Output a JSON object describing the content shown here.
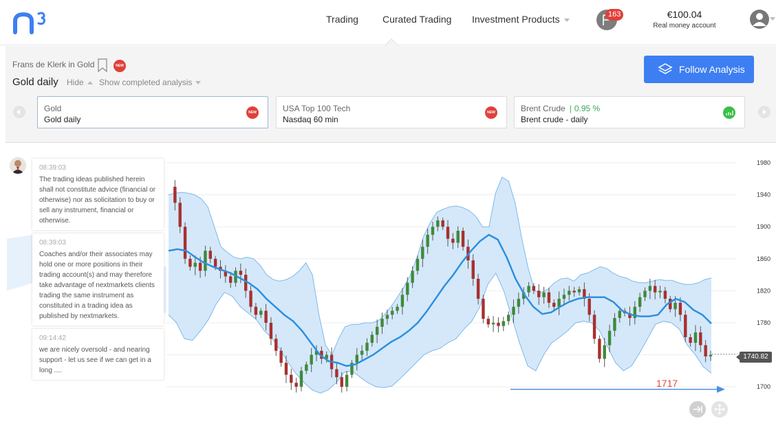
{
  "nav": {
    "logo_text": "n3",
    "items": [
      {
        "label": "Trading",
        "dropdown": false
      },
      {
        "label": "Curated Trading",
        "dropdown": false
      },
      {
        "label": "Investment Products",
        "dropdown": true
      }
    ],
    "notifications_count": "163",
    "account_balance": "€100.04",
    "account_type": "Real money account"
  },
  "analysis": {
    "breadcrumb": "Frans de Klerk in Gold",
    "new_badge": "NEW",
    "title": "Gold daily",
    "hide_label": "Hide",
    "show_completed_label": "Show completed analysis",
    "follow_button": "Follow Analysis",
    "cards": [
      {
        "market": "Gold",
        "name": "Gold daily",
        "change": "",
        "badge": "NEW",
        "active": true
      },
      {
        "market": "USA Top 100 Tech",
        "name": "Nasdaq 60 min",
        "change": "",
        "badge": "NEW",
        "active": false
      },
      {
        "market": "Brent Crude",
        "name": "Brent crude - daily",
        "change": "0.95 %",
        "badge": "chart-up-icon",
        "active": false
      }
    ]
  },
  "feed": [
    {
      "time": "08:39:03",
      "text": "The trading ideas published herein shall not constitute advice (financial or otherwise) nor as solicitation to buy or sell any instrument, financial or otherwise."
    },
    {
      "time": "08:39:03",
      "text": "Coaches and/or their associates may hold one or more positions in their trading account(s) and may therefore take advantage of nextmarkets clients trading the same instrument as constituted in a trading idea as published by nextmarkets."
    },
    {
      "time": "09:14:42",
      "text": "we are nicely oversold - and nearing support - let us see if we can get in a long ...."
    }
  ],
  "colors": {
    "accent": "#3d7ff2",
    "bollinger_fill": "#cce4f9",
    "bollinger_edge": "#7fb8ea",
    "mid_line": "#2e8fdc",
    "up_candle": "#3f8a3a",
    "down_candle": "#a83030",
    "annotation": "#e04a3c"
  },
  "chart_data": {
    "type": "candlestick",
    "ylim": [
      1680,
      1990
    ],
    "y_ticks": [
      "1980",
      "1940",
      "1900",
      "1860",
      "1820",
      "1780",
      "1740",
      "1700"
    ],
    "last_price": "1740.82",
    "support_level": 1717,
    "support_label": "1717",
    "price_path": [
      1950,
      1930,
      1900,
      1860,
      1850,
      1855,
      1845,
      1870,
      1860,
      1850,
      1845,
      1838,
      1830,
      1845,
      1840,
      1820,
      1800,
      1790,
      1795,
      1780,
      1760,
      1745,
      1730,
      1715,
      1705,
      1700,
      1720,
      1728,
      1740,
      1745,
      1735,
      1740,
      1722,
      1712,
      1700,
      1715,
      1730,
      1740,
      1745,
      1755,
      1765,
      1775,
      1785,
      1790,
      1795,
      1800,
      1815,
      1830,
      1845,
      1860,
      1875,
      1890,
      1900,
      1908,
      1900,
      1885,
      1880,
      1895,
      1875,
      1858,
      1835,
      1810,
      1785,
      1778,
      1780,
      1776,
      1782,
      1790,
      1800,
      1810,
      1818,
      1826,
      1820,
      1812,
      1818,
      1805,
      1800,
      1810,
      1815,
      1820,
      1818,
      1822,
      1810,
      1790,
      1760,
      1735,
      1752,
      1770,
      1786,
      1795,
      1792,
      1786,
      1800,
      1812,
      1820,
      1826,
      1818,
      1820,
      1810,
      1797,
      1805,
      1790,
      1762,
      1755,
      1768,
      1752,
      1738,
      1740
    ],
    "upper_band_path": [
      1940,
      1942,
      1943,
      1942,
      1940,
      1935,
      1925,
      1900,
      1875,
      1868,
      1862,
      1860,
      1862,
      1860,
      1852,
      1840,
      1834,
      1832,
      1834,
      1838,
      1845,
      1855,
      1840,
      1790,
      1752,
      1740,
      1760,
      1775,
      1778,
      1778,
      1780,
      1780,
      1782,
      1790,
      1800,
      1812,
      1825,
      1840,
      1862,
      1888,
      1905,
      1918,
      1922,
      1925,
      1926,
      1924,
      1920,
      1913,
      1900,
      1900,
      1942,
      1962,
      1957,
      1930,
      1886,
      1848,
      1820,
      1818,
      1822,
      1830,
      1835,
      1836,
      1832,
      1840,
      1842,
      1846,
      1850,
      1848,
      1842,
      1838,
      1836,
      1832,
      1830,
      1830,
      1832,
      1834,
      1833,
      1833,
      1830,
      1828,
      1828,
      1830,
      1834,
      1836
    ],
    "lower_band_path": [
      1790,
      1780,
      1760,
      1758,
      1770,
      1784,
      1804,
      1818,
      1813,
      1800,
      1792,
      1784,
      1770,
      1760,
      1746,
      1730,
      1716,
      1705,
      1696,
      1692,
      1696,
      1705,
      1718,
      1720,
      1712,
      1705,
      1700,
      1699,
      1701,
      1710,
      1720,
      1730,
      1740,
      1745,
      1748,
      1755,
      1760,
      1772,
      1782,
      1800,
      1828,
      1842,
      1820,
      1787,
      1754,
      1726,
      1720,
      1740,
      1755,
      1762,
      1770,
      1780,
      1782,
      1780,
      1770,
      1750,
      1730,
      1720,
      1726,
      1742,
      1760,
      1778,
      1782,
      1780,
      1772,
      1752,
      1740,
      1725,
      1717
    ],
    "moving_average_path": [
      1870,
      1872,
      1870,
      1862,
      1855,
      1850,
      1846,
      1842,
      1836,
      1830,
      1822,
      1810,
      1800,
      1790,
      1782,
      1770,
      1755,
      1740,
      1732,
      1730,
      1726,
      1728,
      1734,
      1740,
      1748,
      1756,
      1762,
      1770,
      1780,
      1794,
      1810,
      1826,
      1840,
      1856,
      1870,
      1882,
      1890,
      1884,
      1862,
      1835,
      1815,
      1800,
      1791,
      1793,
      1800,
      1806,
      1810,
      1812,
      1812,
      1812,
      1806,
      1795,
      1790,
      1788,
      1788,
      1790,
      1803,
      1810,
      1806,
      1796,
      1790,
      1779
    ]
  }
}
